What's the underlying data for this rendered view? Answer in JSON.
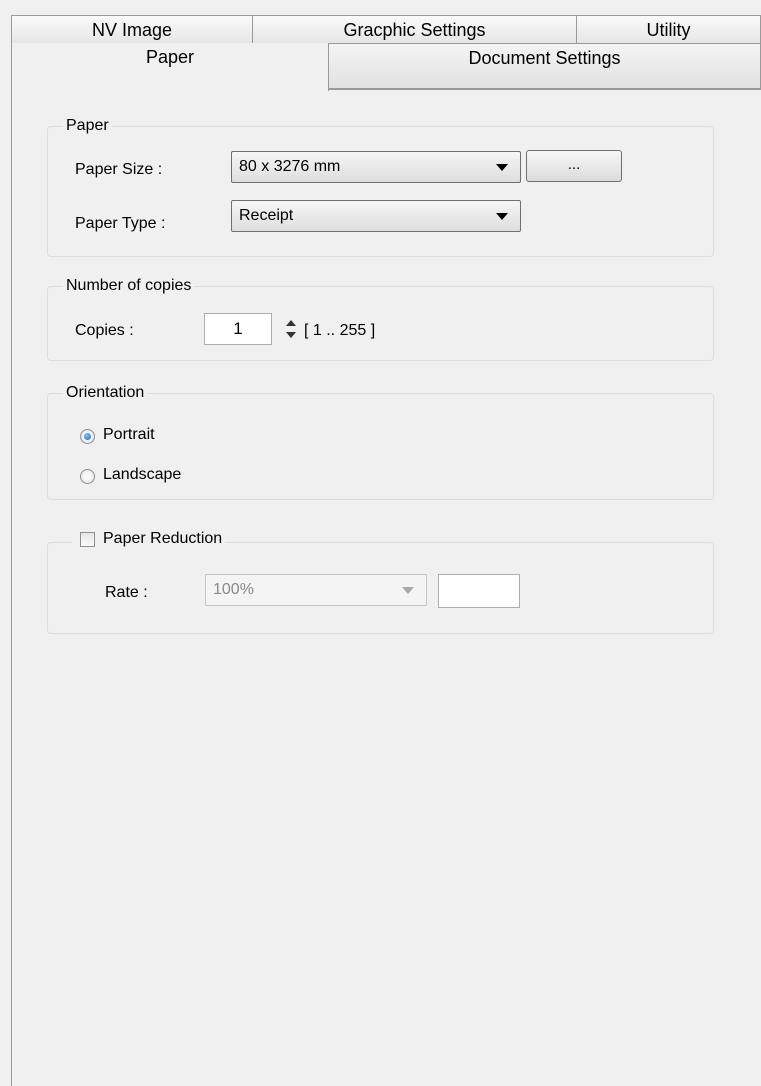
{
  "tabs": {
    "back_row": [
      {
        "label": "NV Image"
      },
      {
        "label": "Gracphic Settings"
      },
      {
        "label": "Utility"
      }
    ],
    "front_row": [
      {
        "label": "Paper",
        "active": true
      },
      {
        "label": "Document Settings",
        "active": false
      }
    ]
  },
  "paper_group": {
    "title": "Paper",
    "size_label": "Paper Size :",
    "size_value": "80 x 3276 mm",
    "browse_label": "...",
    "type_label": "Paper Type :",
    "type_value": "Receipt"
  },
  "copies_group": {
    "title": "Number of copies",
    "copies_label": "Copies :",
    "copies_value": "1",
    "range_text": "[ 1 .. 255 ]"
  },
  "orientation_group": {
    "title": "Orientation",
    "options": [
      {
        "label": "Portrait",
        "selected": true
      },
      {
        "label": "Landscape",
        "selected": false
      }
    ]
  },
  "reduction_group": {
    "title": "Paper Reduction",
    "checked": false,
    "rate_label": "Rate :",
    "rate_value": "100%",
    "custom_value": ""
  },
  "colors": {
    "window_bg": "#f0f0f0",
    "tab_border": "#9a9a9a",
    "group_border": "#d5dfe5",
    "radio_selected": "#1b62c0",
    "disabled_text": "#8a8a8a"
  }
}
